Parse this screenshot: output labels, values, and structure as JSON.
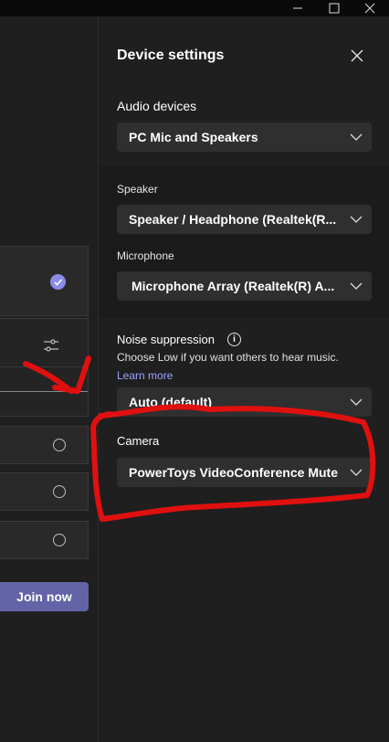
{
  "window": {
    "minimize_icon": "minimize-icon",
    "maximize_icon": "maximize-icon",
    "close_icon": "close-icon"
  },
  "prejoin": {
    "join_label": "Join now"
  },
  "device_settings": {
    "title": "Device settings",
    "audio_devices_label": "Audio devices",
    "audio_devices_value": "PC Mic and Speakers",
    "speaker_label": "Speaker",
    "speaker_value": "Speaker / Headphone (Realtek(R...",
    "microphone_label": "Microphone",
    "microphone_value": "Microphone Array (Realtek(R) A...",
    "noise_label": "Noise suppression",
    "noise_desc": "Choose Low if you want others to hear music.",
    "learn_more": "Learn more",
    "noise_value": "Auto (default)",
    "camera_label": "Camera",
    "camera_value": "PowerToys VideoConference Mute"
  },
  "colors": {
    "accent": "#6264a7",
    "link": "#9ea2ff",
    "annotation": "#e01010"
  }
}
